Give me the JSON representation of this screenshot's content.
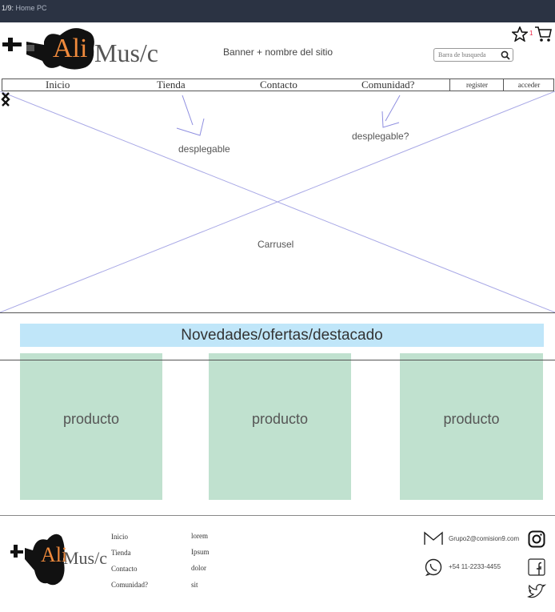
{
  "window": {
    "title_prefix": "1/9:",
    "title": "Home PC"
  },
  "header": {
    "logo_left": "Ali",
    "logo_right": "Mus/c",
    "banner": "Banner + nombre del sitio",
    "search_placeholder": "Barra de busqueda",
    "cart_count": "1"
  },
  "nav": {
    "items": [
      "Inicio",
      "Tienda",
      "Contacto",
      "Comunidad?"
    ],
    "register": "register",
    "login": "acceder"
  },
  "carousel": {
    "label": "Carrusel",
    "note_tienda": "desplegable",
    "note_comunidad": "desplegable?"
  },
  "featured": {
    "title": "Novedades/ofertas/destacado"
  },
  "products": [
    "producto",
    "producto",
    "producto"
  ],
  "footer": {
    "links": [
      "Inicio",
      "Tienda",
      "Contacto",
      "Comunidad?"
    ],
    "placeholders": [
      "lorem",
      "Ipsum",
      "dolor",
      "sit"
    ],
    "email": "Grupo2@comision9.com",
    "phone": "+54 11-2233-4455"
  }
}
